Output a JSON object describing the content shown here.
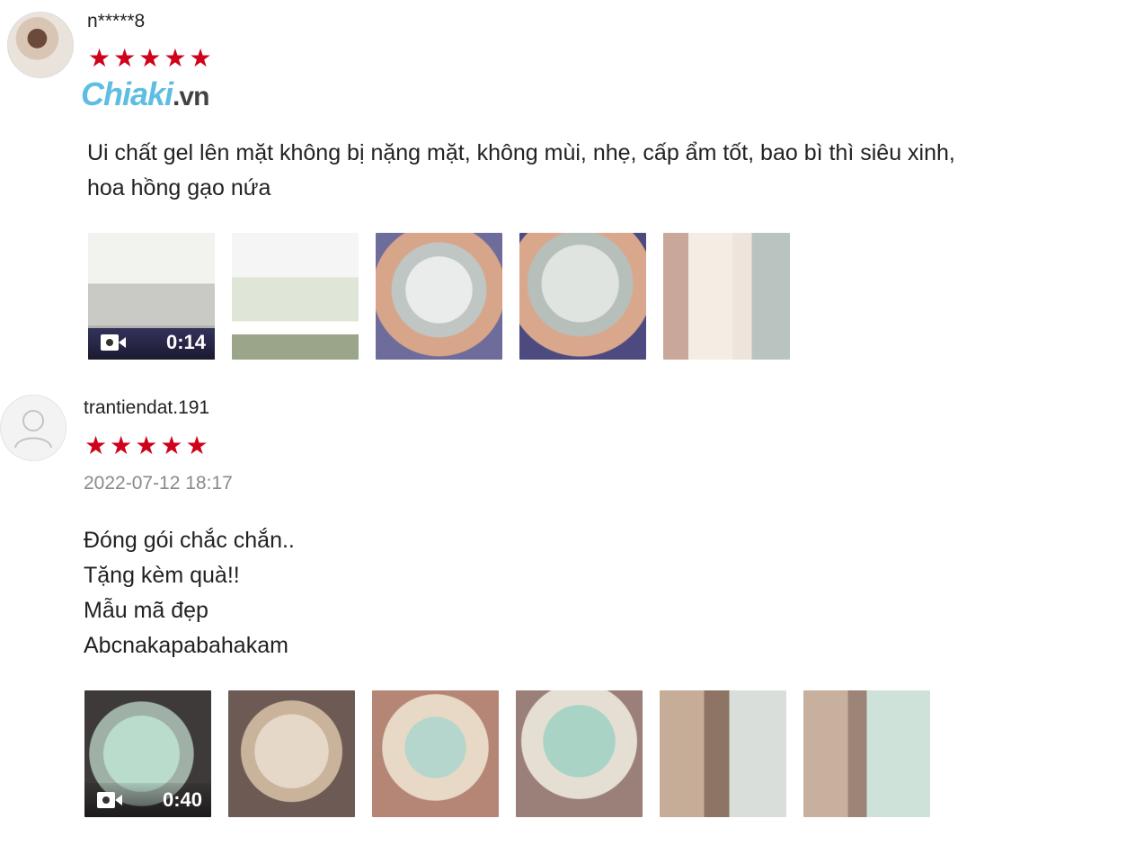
{
  "watermark": {
    "brand": "Chiaki",
    "suffix": ".vn"
  },
  "reviews": [
    {
      "username": "n*****8",
      "stars": [
        "★",
        "★",
        "★",
        "★",
        "★"
      ],
      "date": "",
      "comment": "Ui chất gel lên mặt không bị nặng mặt, không mùi, nhẹ, cấp ẩm tốt, bao bì thì siêu xinh,\nhoa hồng gạo nứa",
      "video_duration": "0:14",
      "photo_count": 5
    },
    {
      "username": "trantiendat.191",
      "stars": [
        "★",
        "★",
        "★",
        "★",
        "★"
      ],
      "date": "2022-07-12 18:17",
      "comment": "Đóng gói chắc chắn..\nTặng kèm quà!!\nMẫu mã đẹp\nAbcnakapabahakam",
      "video_duration": "0:40",
      "photo_count": 6
    }
  ],
  "icons": {
    "avatar_default": "user-icon",
    "video": "video-camera-icon",
    "star": "star-icon"
  },
  "colors": {
    "star": "#d0011b",
    "date": "#8a8a8a",
    "watermark": "#52b8e0"
  }
}
